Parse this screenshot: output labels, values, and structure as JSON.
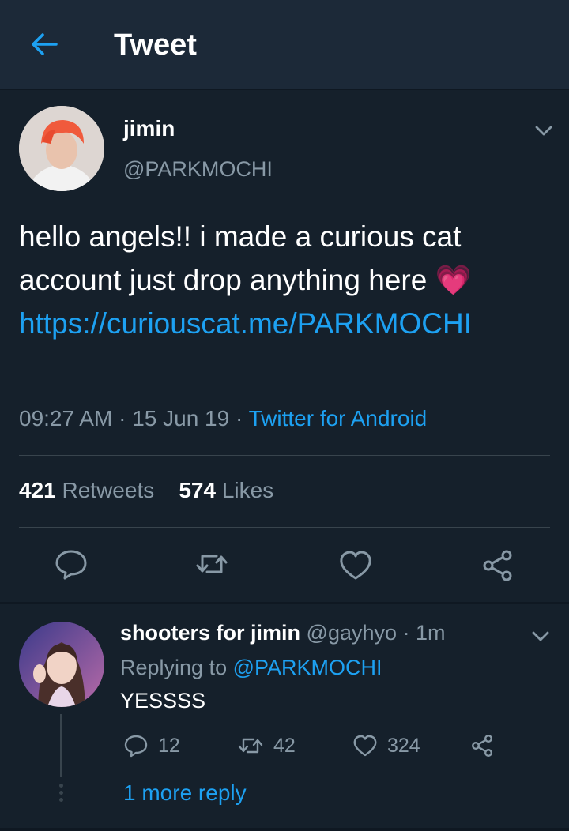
{
  "header": {
    "title": "Tweet",
    "back_icon": "arrow-left-icon",
    "accent": "#1da1f2"
  },
  "tweet": {
    "author_name": "jimin",
    "author_handle": "@PARKMOCHI",
    "text_part1": "hello angels!! i made a curious cat account just drop anything here ",
    "emoji": "💗",
    "link_text": "https://curiouscat.me/PARKMOCHI",
    "time": "09:27 AM",
    "date": "15 Jun 19",
    "source": "Twitter for Android",
    "retweets_count": "421",
    "retweets_label": "Retweets",
    "likes_count": "574",
    "likes_label": "Likes"
  },
  "reply": {
    "author_name": "shooters for jimin",
    "author_handle": "@gayhyo",
    "age": "1m",
    "replying_label": "Replying to",
    "replying_to": "@PARKMOCHI",
    "text": "YESSSS",
    "replies": "12",
    "retweets": "42",
    "likes": "324",
    "more_replies": "1 more reply"
  },
  "colors": {
    "background": "#15202b",
    "header_bg": "#1c2938",
    "muted": "#8899a6",
    "link": "#1da1f2",
    "divider": "#38444d"
  }
}
